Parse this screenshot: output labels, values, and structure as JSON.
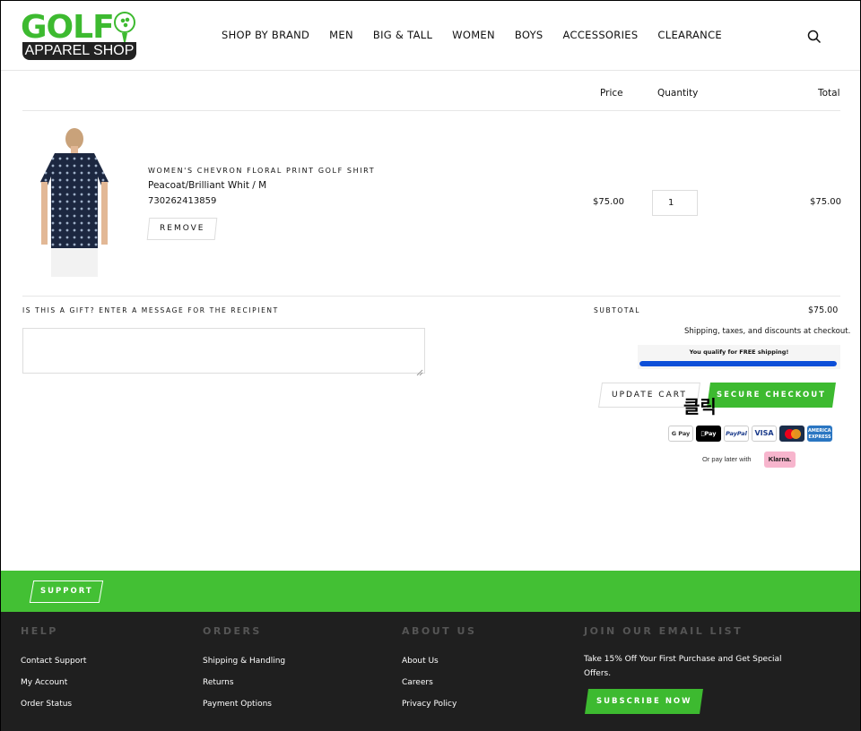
{
  "logo": {
    "wordmark": "GOLF",
    "subtitle": "APPAREL SHOP"
  },
  "nav": {
    "items": [
      "SHOP BY BRAND",
      "MEN",
      "BIG & TALL",
      "WOMEN",
      "BOYS",
      "ACCESSORIES",
      "CLEARANCE"
    ],
    "search_icon": "search-icon"
  },
  "cart": {
    "headers": {
      "price": "Price",
      "quantity": "Quantity",
      "total": "Total"
    },
    "item": {
      "title": "WOMEN'S CHEVRON FLORAL PRINT GOLF SHIRT",
      "variant": "Peacoat/Brilliant Whit / M",
      "sku": "730262413859",
      "remove_label": "REMOVE",
      "price": "$75.00",
      "quantity": "1",
      "total": "$75.00"
    },
    "gift_label": "IS THIS A GIFT? ENTER A MESSAGE FOR THE RECIPIENT",
    "gift_message": "",
    "subtotal_label": "SUBTOTAL",
    "subtotal_value": "$75.00",
    "shipping_note": "Shipping, taxes, and discounts at checkout.",
    "free_shipping_text": "You qualify for FREE shipping!",
    "free_shipping_progress": 1.0,
    "update_label": "UPDATE CART",
    "checkout_label": "SECURE CHECKOUT",
    "click_annotation": "클릭",
    "payment_methods": [
      "G Pay",
      "Pay",
      "PayPal",
      "VISA",
      "Mastercard",
      "AMERICAN EXPRESS"
    ],
    "klarna_note": "Or pay later with",
    "klarna_label": "Klarna."
  },
  "footer": {
    "support_label": "SUPPORT",
    "columns": [
      {
        "heading": "HELP",
        "links": [
          "Contact Support",
          "My Account",
          "Order Status"
        ]
      },
      {
        "heading": "ORDERS",
        "links": [
          "Shipping & Handling",
          "Returns",
          "Payment Options"
        ]
      },
      {
        "heading": "ABOUT US",
        "links": [
          "About Us",
          "Careers",
          "Privacy Policy"
        ]
      }
    ],
    "email": {
      "heading": "JOIN OUR EMAIL LIST",
      "promo": "Take 15% Off Your First Purchase and Get Special Offers.",
      "subscribe_label": "SUBSCRIBE NOW"
    }
  },
  "colors": {
    "brand_green": "#3dba30",
    "progress_blue": "#0d4fd8",
    "footer_bg": "#1f1f1f"
  }
}
